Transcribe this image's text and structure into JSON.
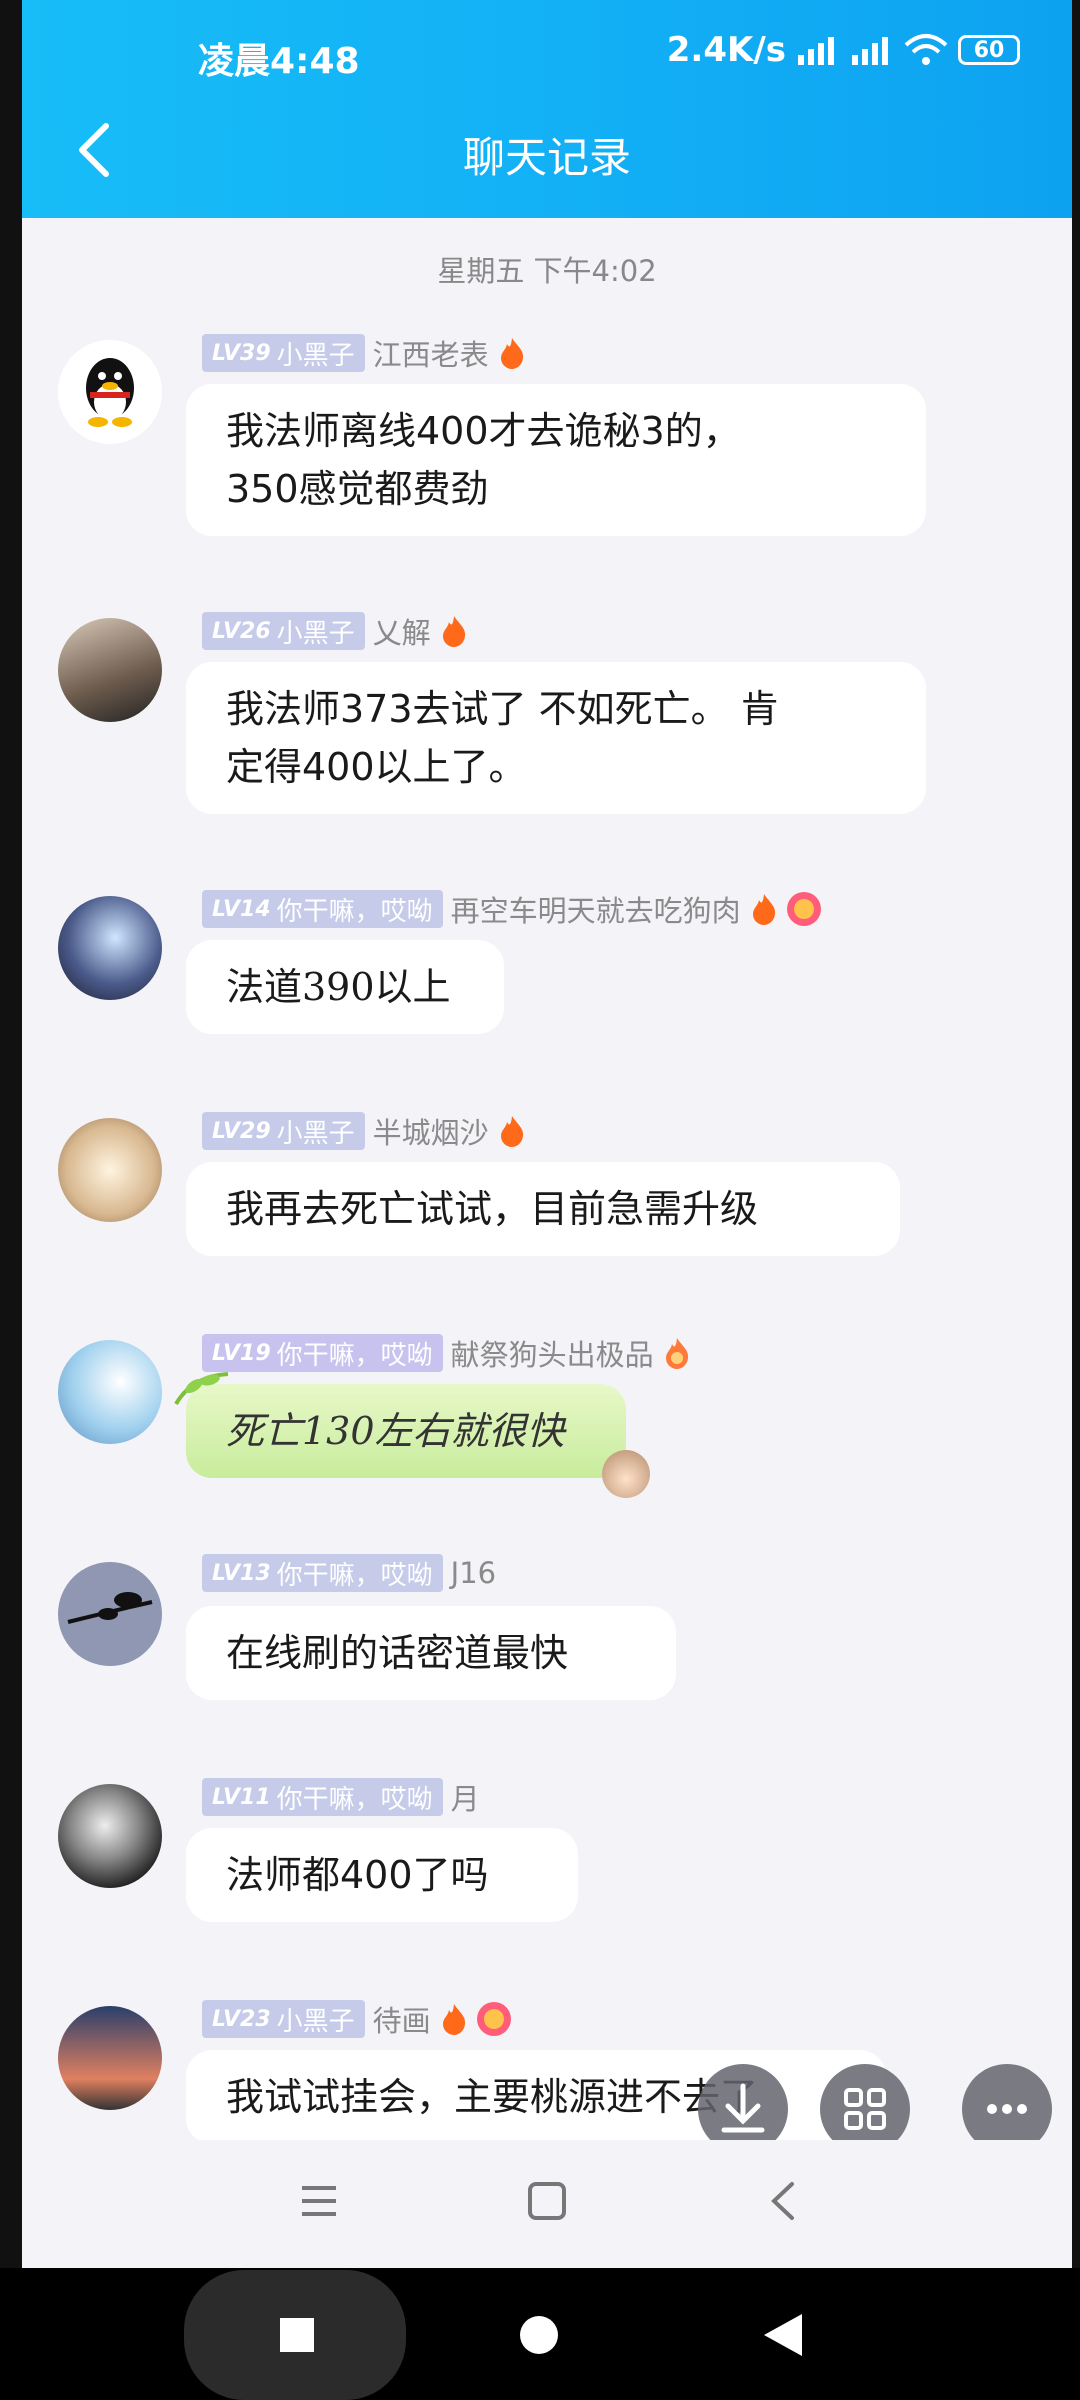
{
  "status": {
    "time": "凌晨4:48",
    "speed": "2.4K/s",
    "battery": "60"
  },
  "header": {
    "title": "聊天记录"
  },
  "timestamp": "星期五 下午4:02",
  "messages": [
    {
      "level": "LV39",
      "title": "小黑子",
      "nick": "江西老表",
      "text": "我法师离线400才去诡秘3的，\n350感觉都费劲"
    },
    {
      "level": "LV26",
      "title": "小黑子",
      "nick": "乂解",
      "text": "我法师373去试了 不如死亡。 肯\n定得400以上了。"
    },
    {
      "level": "LV14",
      "title": "你干嘛，哎呦",
      "nick": "再空车明天就去吃狗肉",
      "text": "法道390以上"
    },
    {
      "level": "LV29",
      "title": "小黑子",
      "nick": "半城烟沙",
      "text": "我再去死亡试试，目前急需升级"
    },
    {
      "level": "LV19",
      "title": "你干嘛，哎呦",
      "nick": "献祭狗头出极品",
      "text": "死亡130左右就很快"
    },
    {
      "level": "LV13",
      "title": "你干嘛，哎呦",
      "nick": "J16",
      "text": "在线刷的话密道最快"
    },
    {
      "level": "LV11",
      "title": "你干嘛，哎呦",
      "nick": "月",
      "text": "法师都400了吗"
    },
    {
      "level": "LV23",
      "title": "小黑子",
      "nick": "待画",
      "text": "我试试挂会，主要桃源进不去了"
    }
  ]
}
